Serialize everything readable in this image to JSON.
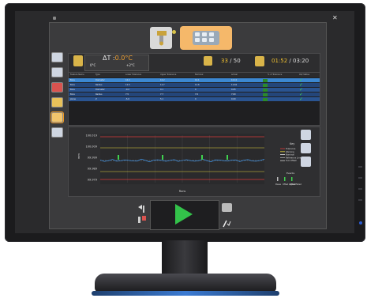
{
  "status": {
    "delta_t_label": "ΔT :",
    "delta_t_value": "0.0°C",
    "temp_low": "0°C",
    "temp_high": "+2°C",
    "count_current": "33",
    "count_sep": " / ",
    "count_total": "50",
    "time_current": "01:52",
    "time_sep": " / ",
    "time_total": "03:20"
  },
  "table": {
    "headers": [
      "Feature Name",
      "Type",
      "Lower Tolerance",
      "Upper Tolerance",
      "Nominal",
      "Actual",
      "% of Tolerance",
      "OK/ Status"
    ],
    "rows": [
      [
        "Bore",
        "Diameter",
        "10.0",
        "10.2",
        "10.1",
        "10.10",
        "",
        "✓"
      ],
      [
        "Bore",
        "Radius",
        "11.5",
        "11.7",
        "11.6",
        "11.62",
        "",
        "✓"
      ],
      [
        "Bore",
        "Diameter",
        "-0.2",
        "0.1",
        "0",
        "0.05",
        "",
        "✓"
      ],
      [
        "Bore",
        "Radius",
        "7.5",
        "7.7",
        "7.6",
        "7.60",
        "",
        "✓"
      ],
      [
        "plane",
        "Z",
        "-5.0",
        "5.1",
        "0",
        "0.00",
        "",
        "✓"
      ]
    ],
    "colors": {
      "selected": "#3c88d2",
      "ok": "#3fd14f",
      "status_bar": "#2b8a2b"
    }
  },
  "chart_data": {
    "type": "line",
    "ylabel": "mm",
    "xlabel": "Runs",
    "yticks": [
      "100.019",
      "100.009",
      "99.999",
      "99.989",
      "99.979"
    ],
    "legend": {
      "title": "Key",
      "items": [
        "Tolerance",
        "Warning",
        "Nominal",
        "Reference Line",
        "Tool Offset"
      ],
      "events_title": "Events",
      "event_items": [
        "Pause",
        "Offset Applied",
        "Offset Failed"
      ]
    },
    "colors": {
      "tolerance": "#d83a3a",
      "warning": "#e0d23a",
      "nominal": "#e6e6e6",
      "series": "#3fa0ff",
      "event": "#3fd14f"
    }
  }
}
